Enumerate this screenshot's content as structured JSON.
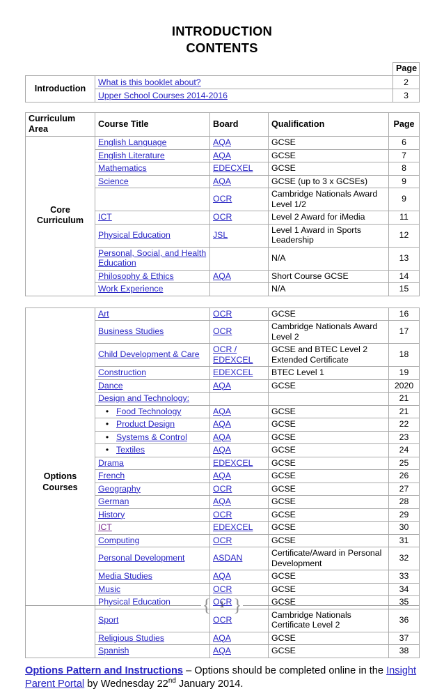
{
  "titles": {
    "line1": "INTRODUCTION",
    "line2": "CONTENTS"
  },
  "intro_table": {
    "page_header": "Page",
    "row_label": "Introduction",
    "rows": [
      {
        "title": "What is this booklet about?",
        "page": "2"
      },
      {
        "title": "Upper School Courses 2014-2016",
        "page": "3"
      }
    ]
  },
  "courses_table": {
    "headers": {
      "area": "Curriculum Area",
      "course": "Course Title",
      "board": "Board",
      "qualification": "Qualification",
      "page": "Page"
    },
    "core_label": "Core Curriculum",
    "core_rows": [
      {
        "course": "English Language",
        "board": "AQA",
        "qualification": "GCSE",
        "page": "6"
      },
      {
        "course": "English Literature",
        "board": "AQA",
        "qualification": "GCSE",
        "page": "7"
      },
      {
        "course": "Mathematics",
        "board": "EDECXEL",
        "qualification": "GCSE",
        "page": "8"
      },
      {
        "course": "Science",
        "board": "AQA",
        "qualification": "GCSE (up to 3 x GCSEs)",
        "page": "9"
      },
      {
        "course": "",
        "board": "OCR",
        "qualification": "Cambridge Nationals Award Level 1/2",
        "page": "9"
      },
      {
        "course": "ICT",
        "board": "OCR",
        "qualification": "Level 2 Award for iMedia",
        "page": "11"
      },
      {
        "course": "Physical Education",
        "board": "JSL",
        "qualification": "Level 1 Award in Sports Leadership",
        "page": "12"
      },
      {
        "course": "Personal, Social, and Health Education",
        "board": "",
        "qualification": "N/A",
        "page": "13"
      },
      {
        "course": "Philosophy & Ethics",
        "board": "AQA",
        "qualification": "Short Course GCSE",
        "page": "14"
      },
      {
        "course": "Work Experience",
        "board": "",
        "qualification": "N/A",
        "page": "15"
      }
    ],
    "options_label": "Options Courses",
    "options_rows": [
      {
        "course": "Art",
        "board": "OCR",
        "qualification": "GCSE",
        "page": "16"
      },
      {
        "course": "Business Studies",
        "board": "OCR",
        "qualification": "Cambridge Nationals Award Level 2",
        "page": "17"
      },
      {
        "course": "Child Development & Care",
        "board": "OCR / EDEXCEL",
        "qualification": "GCSE and BTEC Level 2 Extended Certificate",
        "page": "18"
      },
      {
        "course": "Construction",
        "board": "EDEXCEL",
        "qualification": "BTEC Level 1",
        "page": "19"
      },
      {
        "course": "Dance",
        "board": "AQA",
        "qualification": "GCSE",
        "page": "2020"
      },
      {
        "course": "Design and Technology:",
        "board": "",
        "qualification": "",
        "page": "21"
      },
      {
        "course": "Food Technology",
        "board": "AQA",
        "qualification": "GCSE",
        "page": "21",
        "bullet": true
      },
      {
        "course": "Product Design",
        "board": "AQA",
        "qualification": "GCSE",
        "page": "22",
        "bullet": true
      },
      {
        "course": "Systems & Control",
        "board": "AQA",
        "qualification": "GCSE",
        "page": "23",
        "bullet": true
      },
      {
        "course": "Textiles",
        "board": "AQA",
        "qualification": "GCSE",
        "page": "24",
        "bullet": true
      },
      {
        "course": "Drama",
        "board": "EDEXCEL",
        "qualification": "GCSE",
        "page": "25"
      },
      {
        "course": "French",
        "board": "AQA",
        "qualification": "GCSE",
        "page": "26"
      },
      {
        "course": "Geography",
        "board": "OCR",
        "qualification": "GCSE",
        "page": "27"
      },
      {
        "course": "German",
        "board": "AQA",
        "qualification": "GCSE",
        "page": "28"
      },
      {
        "course": "History",
        "board": "OCR",
        "qualification": "GCSE",
        "page": "29"
      },
      {
        "course": "ICT",
        "board": "EDEXCEL",
        "qualification": "GCSE",
        "page": "30",
        "visited": true
      },
      {
        "course": "Computing",
        "board": "OCR",
        "qualification": "GCSE",
        "page": "31"
      },
      {
        "course": "Personal Development",
        "board": "ASDAN",
        "qualification": "Certificate/Award in Personal Development",
        "page": "32"
      },
      {
        "course": "Media Studies",
        "board": "AQA",
        "qualification": "GCSE",
        "page": "33"
      },
      {
        "course": "Music",
        "board": "OCR",
        "qualification": "GCSE",
        "page": "34"
      },
      {
        "course": "Physical Education",
        "board": "OCR",
        "qualification": "GCSE",
        "page": "35"
      },
      {
        "course": "Sport",
        "board": "OCR",
        "qualification": "Cambridge Nationals Certificate Level 2",
        "page": "36"
      },
      {
        "course": "Religious Studies",
        "board": "AQA",
        "qualification": "GCSE",
        "page": "37"
      },
      {
        "course": "Spanish",
        "board": "AQA",
        "qualification": "GCSE",
        "page": "38"
      }
    ]
  },
  "footer_note": {
    "link_bold": "Options Pattern and Instructions",
    "text_1": " – Options should be completed online in the ",
    "link_inline": "Insight Parent Portal",
    "text_2": " by Wednesday 22",
    "superscript": "nd",
    "text_3": " January 2014."
  },
  "page_footer": {
    "brace_left": "{",
    "number": "1",
    "brace_right": "}"
  },
  "bullet_glyph": "•",
  "colors": {
    "link": "#2926C4",
    "visited_link": "#7B2B8F",
    "border": "#A9A9A9",
    "footer_rule": "#9C9C9C"
  }
}
